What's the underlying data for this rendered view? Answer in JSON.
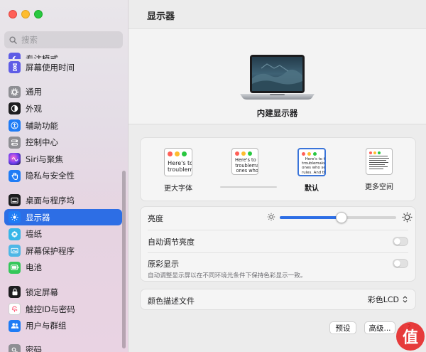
{
  "search": {
    "placeholder": "搜索"
  },
  "sidebar": {
    "top_partial": {
      "label": "专注模式",
      "icon": "moon-icon",
      "color": "#5e5ce6"
    },
    "screen_time": {
      "label": "屏幕使用时间",
      "icon": "hourglass-icon",
      "color": "#5e5ce6"
    },
    "group2": [
      {
        "label": "通用",
        "icon": "gear-icon",
        "color": "#8e8e93"
      },
      {
        "label": "外观",
        "icon": "appearance-icon",
        "color": "#1d1d1f"
      },
      {
        "label": "辅助功能",
        "icon": "accessibility-icon",
        "color": "#1f7cf5"
      },
      {
        "label": "控制中心",
        "icon": "control-center-icon",
        "color": "#8e8e93"
      },
      {
        "label": "Siri与聚焦",
        "icon": "siri-icon",
        "color": "#8a3cd6"
      },
      {
        "label": "隐私与安全性",
        "icon": "hand-icon",
        "color": "#1f7cf5"
      }
    ],
    "group3": [
      {
        "label": "桌面与程序坞",
        "icon": "dock-icon",
        "color": "#1d1d1f"
      },
      {
        "label": "显示器",
        "icon": "sun-icon",
        "color": "#1f7cf5",
        "active": true
      },
      {
        "label": "墙纸",
        "icon": "wallpaper-icon",
        "color": "#38b6e8"
      },
      {
        "label": "屏幕保护程序",
        "icon": "screensaver-icon",
        "color": "#4fb7e6"
      },
      {
        "label": "电池",
        "icon": "battery-icon",
        "color": "#34c759"
      }
    ],
    "group4": [
      {
        "label": "锁定屏幕",
        "icon": "lock-icon",
        "color": "#1d1d1f"
      },
      {
        "label": "触控ID与密码",
        "icon": "fingerprint-icon",
        "color": "#ffffff"
      },
      {
        "label": "用户与群组",
        "icon": "users-icon",
        "color": "#1f7cf5"
      }
    ],
    "bottom_partial": {
      "label": "密码",
      "icon": "key-icon",
      "color": "#8e8e93"
    }
  },
  "main": {
    "title": "显示器",
    "display_name": "内建显示器",
    "resolution_options": [
      {
        "label": "更大字体",
        "selected": false,
        "sample": "Here's to\ntroublem"
      },
      {
        "label": "",
        "selected": false,
        "sample": "Here's to t\ntroublema\nones who"
      },
      {
        "label": "默认",
        "selected": true,
        "sample": "Here's to th\ntroublemakers,\nones who see t\nrules. And they"
      },
      {
        "label": "更多空间",
        "selected": false,
        "sample": ""
      }
    ],
    "brightness": {
      "label": "亮度",
      "level": 0.53
    },
    "auto_brightness": {
      "label": "自动调节亮度",
      "on": false
    },
    "true_tone": {
      "label": "原彩显示",
      "description": "自动调整显示屏以在不同环境光条件下保持色彩显示一致。",
      "on": false
    },
    "color_profile": {
      "label": "颜色描述文件",
      "value": "彩色LCD"
    },
    "buttons": {
      "preset": "预设",
      "advanced": "高级...",
      "help": "?"
    }
  },
  "colors": {
    "accent": "#2d6ee5"
  }
}
